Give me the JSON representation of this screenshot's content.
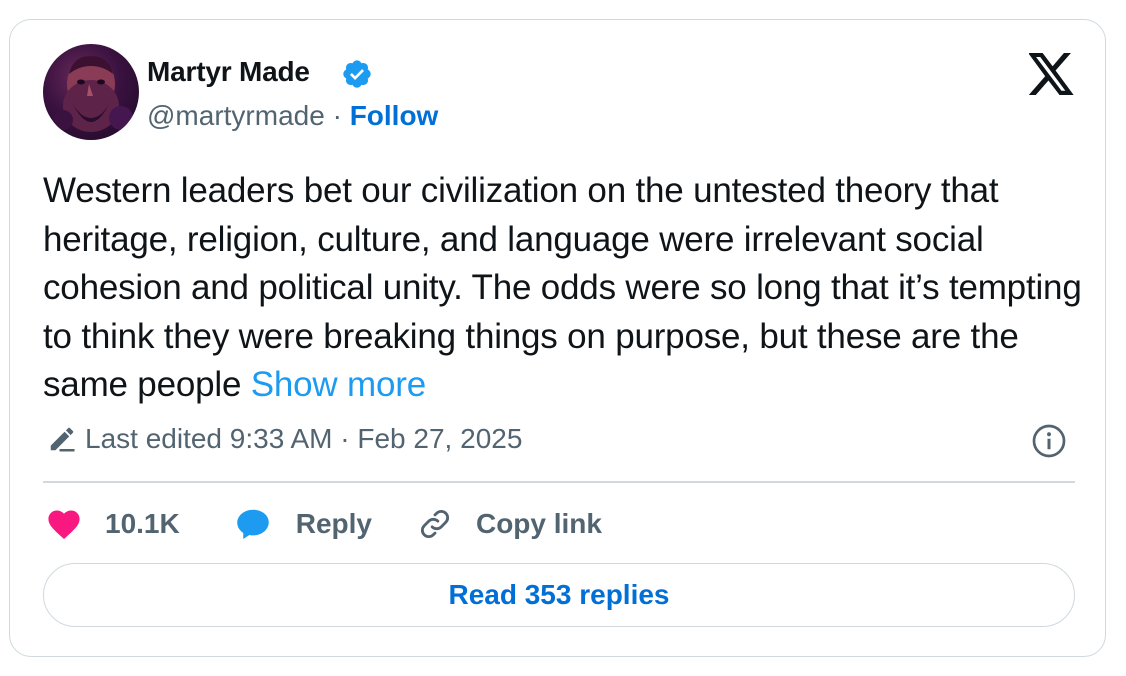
{
  "author": {
    "name": "Martyr Made",
    "handle": "@martyrmade",
    "separator": " · ",
    "follow_label": "Follow",
    "verified": true
  },
  "tweet": {
    "text": "Western leaders bet our civilization on the untested theory that heritage, religion, culture, and language were irrelevant social cohesion and political unity. The odds were so long that it’s tempting to think they were breaking things on purpose, but these are the same people",
    "show_more_label": "Show more"
  },
  "meta": {
    "edited_label": "Last edited 9:33 AM · Feb 27, 2025"
  },
  "actions": {
    "likes_count": "10.1K",
    "reply_label": "Reply",
    "copy_link_label": "Copy link"
  },
  "footer": {
    "read_replies_label": "Read 353 replies"
  },
  "colors": {
    "link_blue": "#006fd6",
    "show_more_blue": "#1d9bf0",
    "like_pink": "#f91880",
    "reply_blue": "#1d9bf0",
    "secondary_text": "#536471",
    "border": "#cfd9de"
  },
  "icons": [
    "avatar",
    "verified-badge-icon",
    "x-logo-icon",
    "edit-pencil-icon",
    "info-icon",
    "heart-icon",
    "reply-bubble-icon",
    "link-icon"
  ]
}
